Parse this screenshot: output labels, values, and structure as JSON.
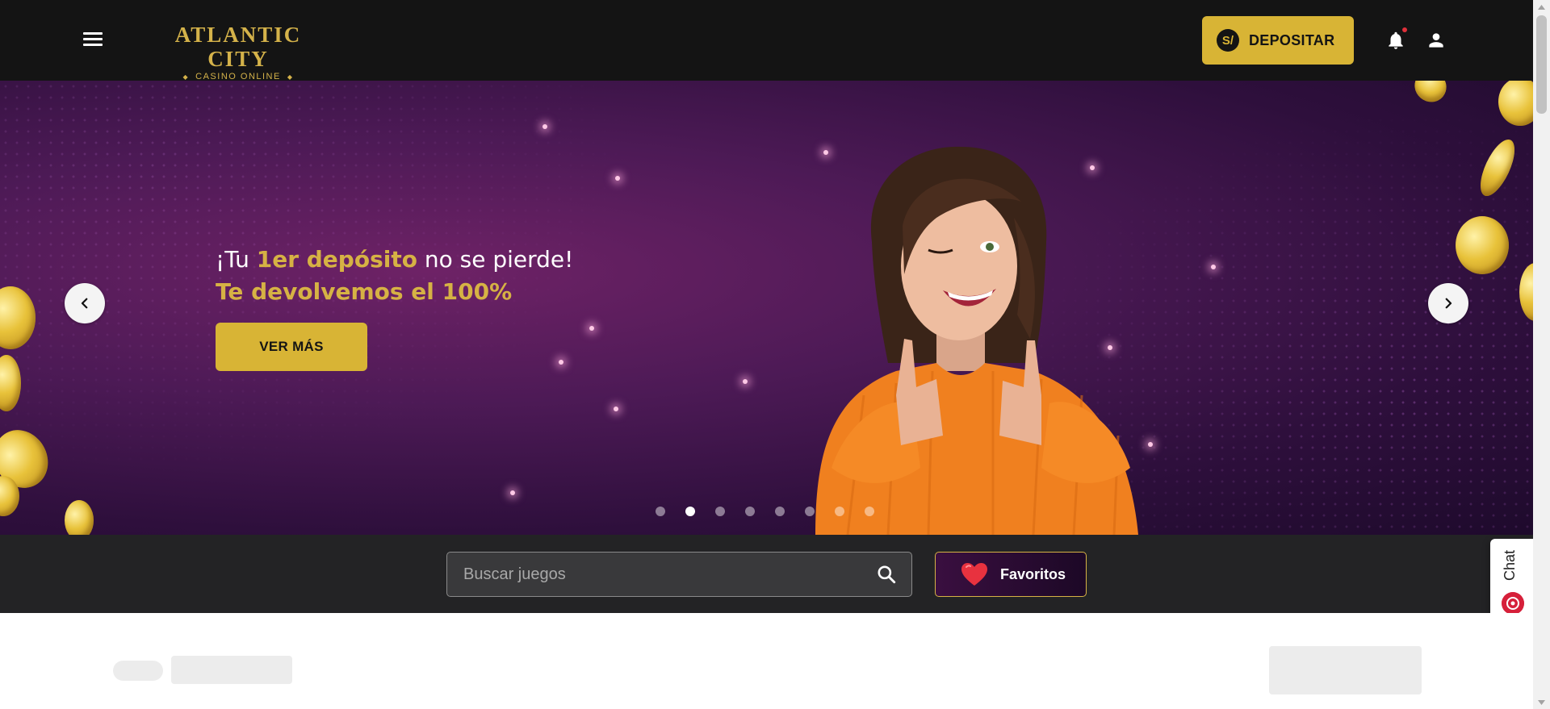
{
  "header": {
    "logo_title": "ATLANTIC CITY",
    "logo_subtitle": "CASINO ONLINE",
    "deposit_icon": "S/",
    "deposit_label": "DEPOSITAR"
  },
  "hero": {
    "headline_prefix": "¡Tu ",
    "headline_highlight": "1er depósito",
    "headline_suffix": " no se pierde!",
    "subheadline": "Te devolvemos el 100%",
    "cta_label": "VER MÁS",
    "slide_count": 8,
    "active_slide": 2
  },
  "search": {
    "placeholder": "Buscar juegos",
    "favorites_label": "Favoritos"
  },
  "chat": {
    "label": "Chat"
  },
  "colors": {
    "header_bg": "#141414",
    "gold": "#d8b435",
    "hero_purple": "#4d1a56",
    "search_strip": "#232325"
  },
  "icons": {
    "menu": "hamburger-icon",
    "bell": "bell-icon",
    "user": "user-icon",
    "prev": "chevron-left-icon",
    "next": "chevron-right-icon",
    "search": "search-icon",
    "heart": "heart-icon",
    "chat": "chat-icon"
  }
}
